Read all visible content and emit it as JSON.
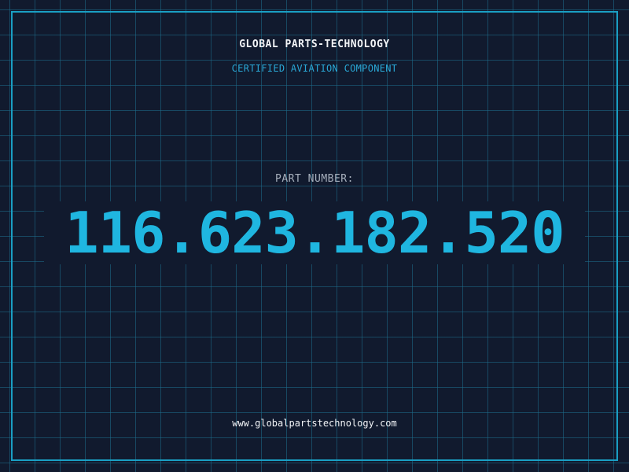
{
  "header": {
    "company": "GLOBAL PARTS-TECHNOLOGY",
    "tagline": "CERTIFIED AVIATION COMPONENT"
  },
  "part": {
    "label": "PART NUMBER:",
    "number": "116.623.182.520"
  },
  "footer": {
    "website": "www.globalpartstechnology.com"
  },
  "colors": {
    "background": "#111a2e",
    "grid": "#1c6e8c",
    "frame": "#1a9fc4",
    "accent": "#1fb6e0",
    "text": "#f2f4f7",
    "muted": "#a7b0bd"
  }
}
